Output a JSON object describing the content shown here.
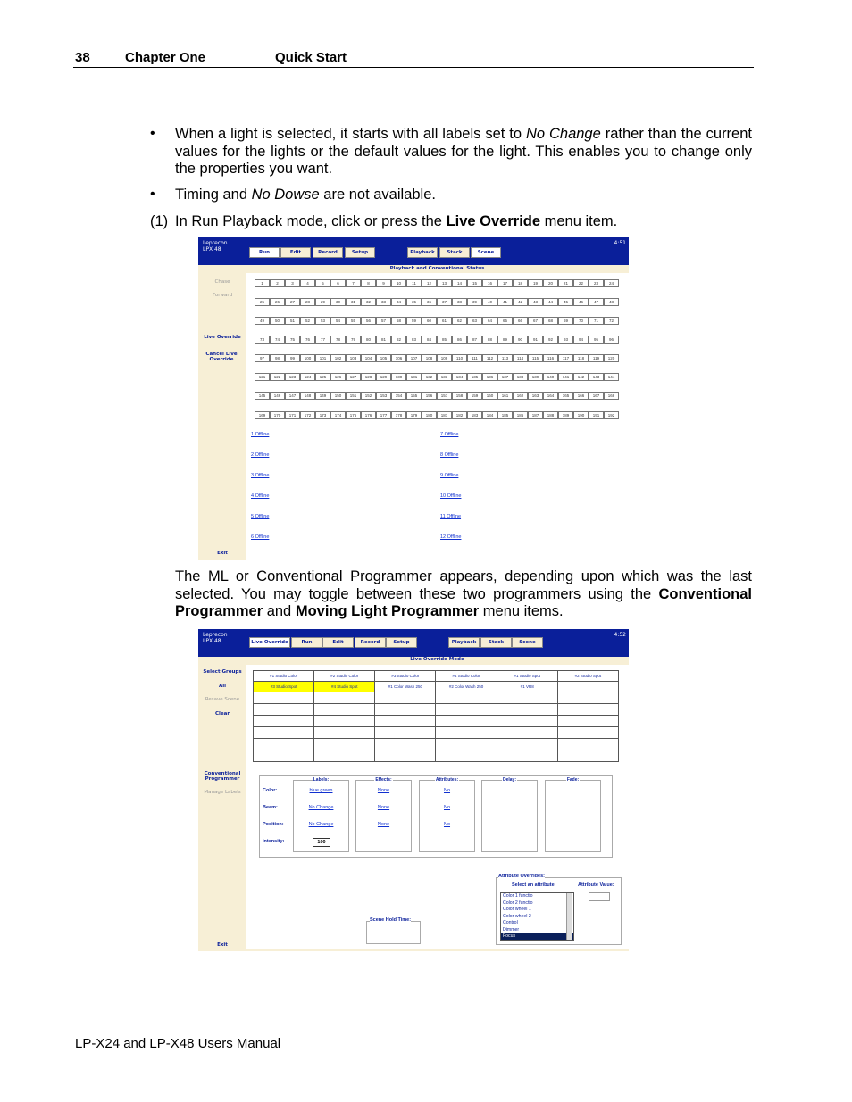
{
  "header": {
    "page_number": "38",
    "chapter": "Chapter One",
    "section": "Quick Start"
  },
  "bullets": [
    {
      "pre": "When a light is selected, it starts with all labels set to ",
      "em": "No Change",
      "post": " rather than the current values for the lights or the default values for the light. This enables you to change only the properties you want."
    },
    {
      "pre": "Timing and ",
      "em": "No Dowse",
      "post": " are not available."
    }
  ],
  "step1": {
    "num": "(1)",
    "pre": "In Run Playback mode, click or press the ",
    "bold": "Live Override",
    "post": " menu item."
  },
  "para2": {
    "a": "The ML or Conventional Programmer appears, depending upon which was the last selected. You may toggle between these two programmers using the ",
    "b1": "Conventional Programmer",
    "c": " and ",
    "b2": "Moving Light Programmer",
    "d": " menu items."
  },
  "footer": "LP-X24 and LP-X48 Users Manual",
  "colors": {
    "title_bar": "#0a1f9a",
    "panel": "#f7efd6",
    "selected": "#ffff00",
    "link": "#1030d0"
  },
  "shot1": {
    "brand": [
      "Leprecon",
      "LPX 48"
    ],
    "clock": "4:51",
    "menu": [
      {
        "label": "Run",
        "active": true
      },
      {
        "label": "Edit"
      },
      {
        "label": "Record"
      },
      {
        "label": "Setup"
      },
      {
        "label": "Playback"
      },
      {
        "label": "Stack"
      },
      {
        "label": "Scene",
        "active": true
      }
    ],
    "title": "Playback and Conventional Status",
    "side": [
      "Chase",
      "Forward",
      "Live Override",
      "Cancel Live Override",
      "Exit"
    ],
    "scene_count": 192,
    "offline_left": [
      "1 Offline",
      "2 Offline",
      "3 Offline",
      "4 Offline",
      "5 Offline",
      "6 Offline"
    ],
    "offline_right": [
      "7 Offline",
      "8 Offline",
      "9 Offline",
      "10 Offline",
      "11 Offline",
      "12 Offline"
    ]
  },
  "shot2": {
    "brand": [
      "Leprecon",
      "LPX 48"
    ],
    "clock": "4:52",
    "menu": [
      {
        "label": "Live Override",
        "active": true
      },
      {
        "label": "Run"
      },
      {
        "label": "Edit"
      },
      {
        "label": "Record"
      },
      {
        "label": "Setup"
      },
      {
        "label": "Playback"
      },
      {
        "label": "Stack"
      },
      {
        "label": "Scene"
      }
    ],
    "title": "Live Override Mode",
    "side": [
      "Select Groups",
      "All",
      "Resave Scene",
      "Clear",
      "Conventional Programmer",
      "Manage Labels",
      "Exit"
    ],
    "groups": [
      [
        "#1 Studio Color",
        "#2 Studio Color",
        "#3 Studio Color",
        "#4 Studio Color",
        "#1 Studio Spot",
        "#2 Studio Spot"
      ],
      [
        "#3 Studio Spot",
        "#4 Studio Spot",
        "#1 Color Wash 250",
        "#2 Color Wash 250",
        "#1 VR8",
        ""
      ]
    ],
    "selected_groups": [
      "#3 Studio Spot",
      "#4 Studio Spot"
    ],
    "boxes": {
      "labels": "Labels:",
      "effects": "Effects:",
      "attributes": "Attributes:",
      "delay": "Delay:",
      "fade": "Fade:"
    },
    "rows": [
      {
        "name": "Color:",
        "label": "blue green",
        "effect": "None",
        "attr": "No"
      },
      {
        "name": "Beam:",
        "label": "No Change",
        "effect": "None",
        "attr": "No"
      },
      {
        "name": "Position:",
        "label": "No Change",
        "effect": "None",
        "attr": "No"
      }
    ],
    "intensity": {
      "name": "Intensity:",
      "value": "100"
    },
    "overrides": {
      "title": "Attribute Overrides:",
      "select": "Select an attribute:",
      "value_label": "Attribute Value:",
      "value": "",
      "items": [
        "Color 1 functio",
        "Color 2 functio",
        "Color wheel 1",
        "Color wheel 2",
        "Control",
        "Dimmer",
        "Focus"
      ],
      "selected": "Focus"
    },
    "scene_hold": "Scene Hold Time:"
  }
}
